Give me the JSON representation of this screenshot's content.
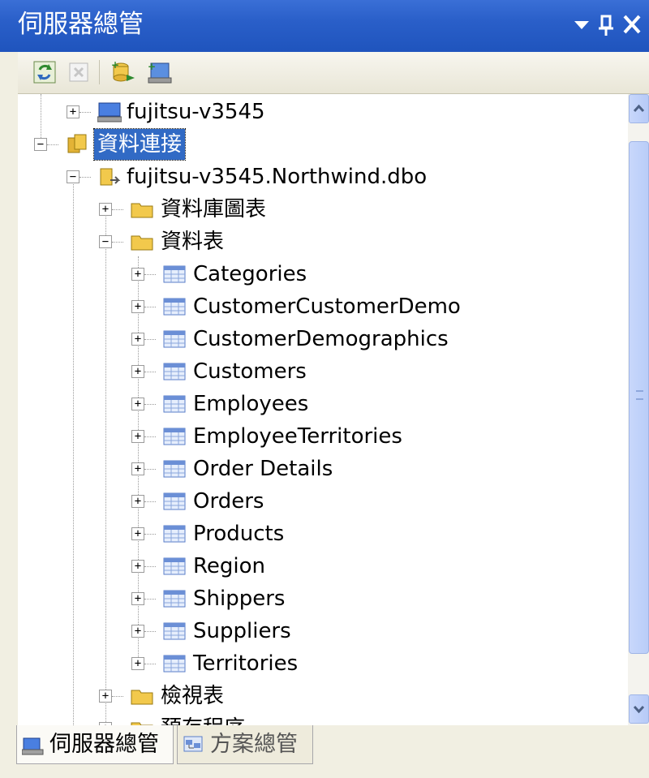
{
  "window": {
    "title": "伺服器總管",
    "controls": {
      "dropdown": "▾",
      "pin": "ꟷ",
      "close": "✕"
    }
  },
  "toolbar": {
    "buttons": [
      {
        "name": "refresh",
        "icon": "refresh-icon"
      },
      {
        "name": "stop",
        "icon": "stop-icon"
      },
      {
        "name": "connect-to-database",
        "icon": "connect-database-icon"
      },
      {
        "name": "connect-to-server",
        "icon": "connect-server-icon"
      }
    ]
  },
  "tree": {
    "server": {
      "label": "fujitsu-v3545",
      "icon": "server-icon"
    },
    "data_connections": {
      "label": "資料連接",
      "icon": "data-connections-icon"
    },
    "connection": {
      "label": "fujitsu-v3545.Northwind.dbo",
      "icon": "database-connection-icon"
    },
    "folders": {
      "diagrams": "資料庫圖表",
      "tables": "資料表",
      "views": "檢視表",
      "stored_procs": "預存程序"
    },
    "tables": [
      "Categories",
      "CustomerCustomerDemo",
      "CustomerDemographics",
      "Customers",
      "Employees",
      "EmployeeTerritories",
      "Order Details",
      "Orders",
      "Products",
      "Region",
      "Shippers",
      "Suppliers",
      "Territories"
    ],
    "expander": {
      "plus": "+",
      "minus": "−"
    }
  },
  "tabs": [
    {
      "label": "伺服器總管",
      "active": true,
      "icon": "server-explorer-icon"
    },
    {
      "label": "方案總管",
      "active": false,
      "icon": "solution-explorer-icon"
    }
  ],
  "colors": {
    "titlebar": "#2a5fc9",
    "selection": "#316ac5",
    "folder": "#f2c94c",
    "table_icon": "#6b8fd6"
  }
}
